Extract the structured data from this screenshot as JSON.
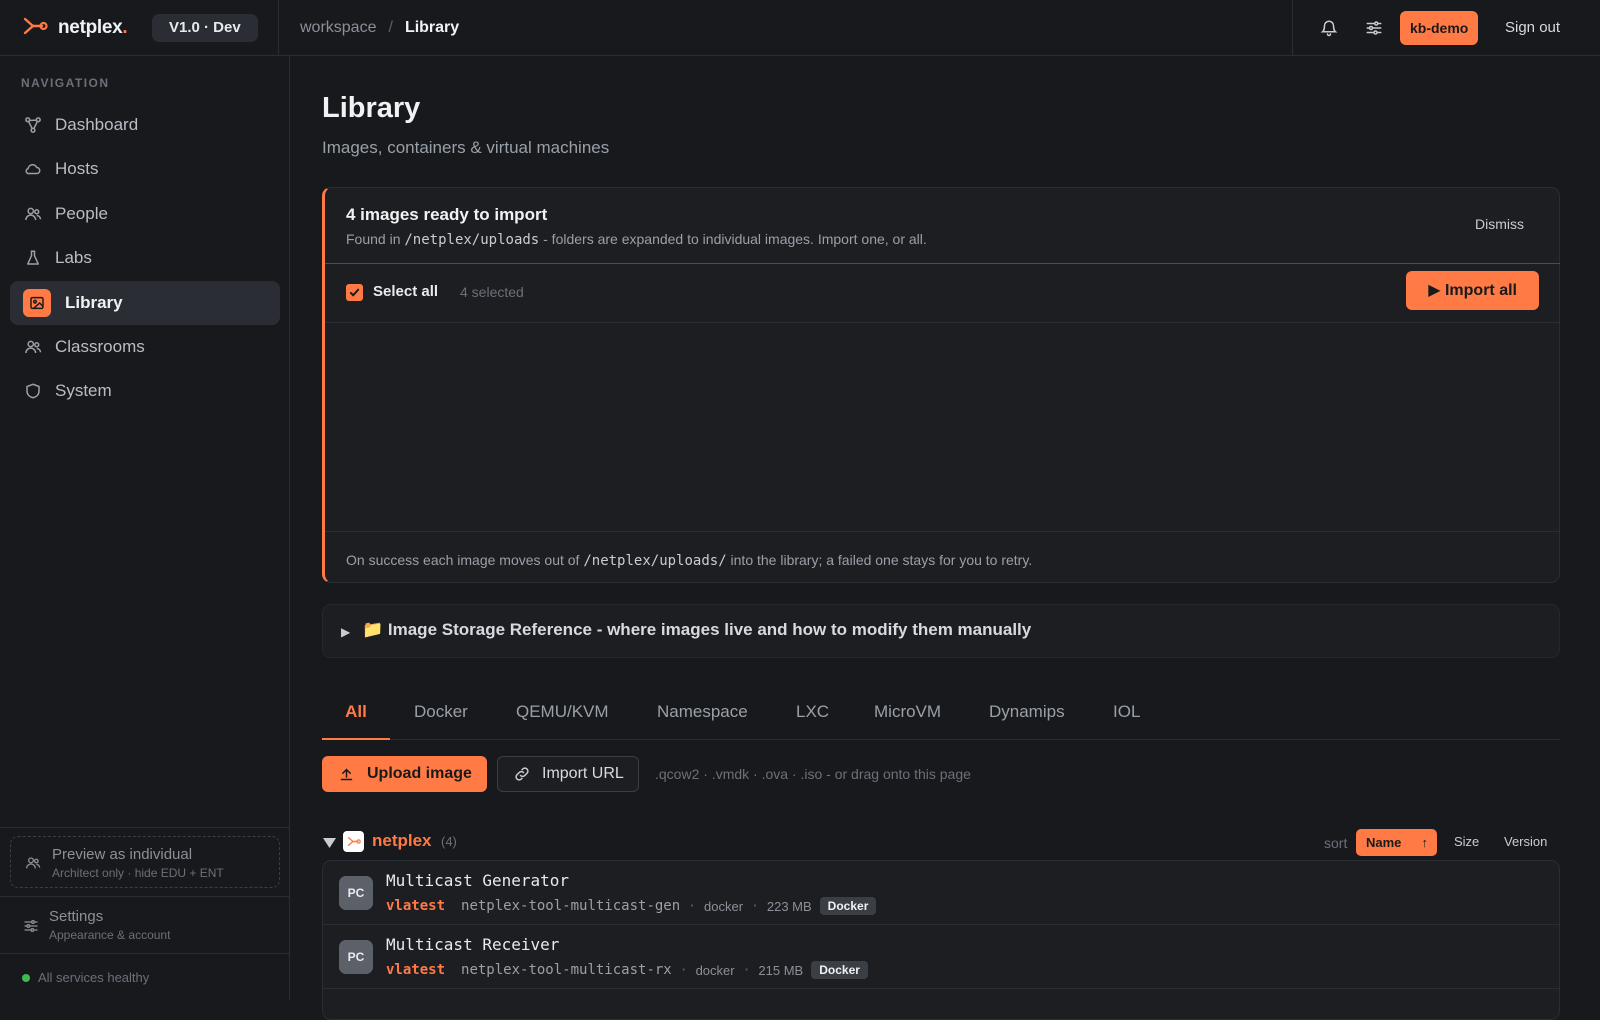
{
  "brand": {
    "name": "netplex",
    "dot": ".",
    "version": "V1.0 · Dev"
  },
  "breadcrumb": {
    "workspace": "workspace",
    "separator": "/",
    "current": "Library"
  },
  "topbar": {
    "user_label": "kb-demo",
    "signout_label": "Sign out"
  },
  "colors": {
    "accent": "#ff7a45",
    "background": "#17191d",
    "panel": "#1c1e22",
    "healthy": "#3fb950"
  },
  "sidebar": {
    "heading": "NAVIGATION",
    "items": [
      {
        "label": "Dashboard",
        "icon": "graph-icon"
      },
      {
        "label": "Hosts",
        "icon": "cloud-icon"
      },
      {
        "label": "People",
        "icon": "people-icon"
      },
      {
        "label": "Labs",
        "icon": "flask-icon"
      },
      {
        "label": "Library",
        "icon": "image-icon",
        "active": true
      },
      {
        "label": "Classrooms",
        "icon": "people-icon"
      },
      {
        "label": "System",
        "icon": "shield-icon"
      }
    ],
    "preview": {
      "title": "Preview as individual",
      "subtitle": "Architect only · hide EDU + ENT"
    },
    "settings": {
      "title": "Settings",
      "subtitle": "Appearance & account"
    },
    "health": "All services healthy"
  },
  "page": {
    "title": "Library",
    "subtitle": "Images, containers & virtual machines"
  },
  "import_card": {
    "title": "4 images ready to import",
    "desc_before": "Found in ",
    "desc_path": "/netplex/uploads",
    "desc_after": " - folders are expanded to individual images. Import one, or all.",
    "dismiss": "Dismiss",
    "select_all": "Select all",
    "selected_count": "4 selected",
    "import_all": "▶ Import all",
    "footer_before": "On success each image moves out of ",
    "footer_path": "/netplex/uploads/",
    "footer_after": " into the library; a failed one stays for you to retry."
  },
  "storage_ref": {
    "label": "📁 Image Storage Reference - where images live and how to modify them manually"
  },
  "tabs": [
    "All",
    "Docker",
    "QEMU/KVM",
    "Namespace",
    "LXC",
    "MicroVM",
    "Dynamips",
    "IOL"
  ],
  "actions": {
    "upload": "Upload image",
    "import_url": "Import URL",
    "hint": ".qcow2 · .vmdk · .ova · .iso - or drag onto this page"
  },
  "group": {
    "name": "netplex",
    "count": "(4)",
    "sort_label": "sort",
    "sort_options": [
      "Name",
      "Size",
      "Version"
    ],
    "sort_arrow": "↑"
  },
  "images": [
    {
      "avatar": "PC",
      "name": "Multicast Generator",
      "version": "vlatest",
      "image": "netplex-tool-multicast-gen",
      "runtime": "docker",
      "size": "223 MB",
      "badge": "Docker"
    },
    {
      "avatar": "PC",
      "name": "Multicast Receiver",
      "version": "vlatest",
      "image": "netplex-tool-multicast-rx",
      "runtime": "docker",
      "size": "215 MB",
      "badge": "Docker"
    }
  ]
}
